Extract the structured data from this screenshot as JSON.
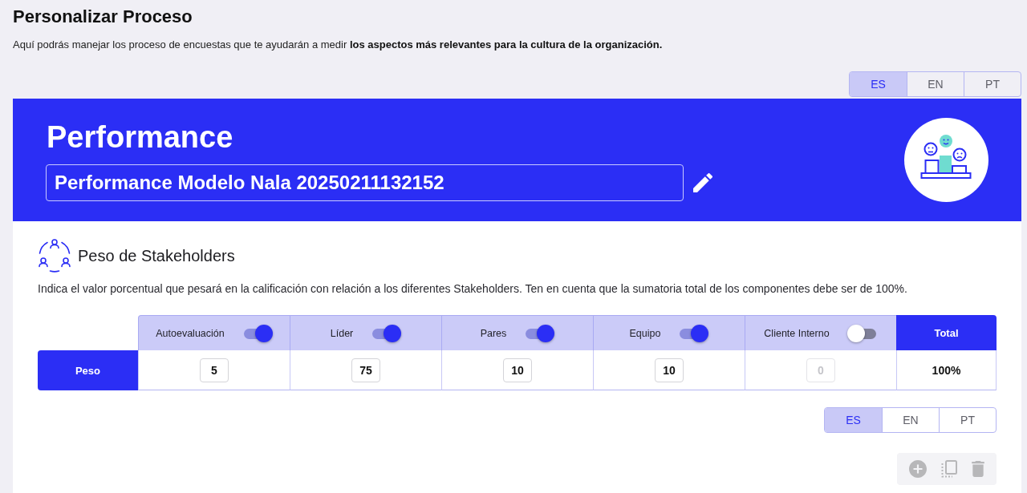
{
  "page": {
    "title": "Personalizar Proceso",
    "description": "Aquí podrás manejar los proceso de encuestas que te ayudarán a medir **los aspectos más relevantes para la cultura de la organización.**"
  },
  "header_language_tabs": [
    {
      "label": "ES",
      "selected": true
    },
    {
      "label": "EN",
      "selected": false
    },
    {
      "label": "PT",
      "selected": false
    }
  ],
  "banner": {
    "title": "Performance",
    "name_field": {
      "value": "Performance Modelo Nala 20250211132152"
    }
  },
  "stakeholders": {
    "title": "Peso de Stakeholders",
    "description": "Indica el valor porcentual que pesará en la calificación con relación a los diferentes Stakeholders. Ten en cuenta que la sumatoria total de los componentes debe ser de 100%.",
    "row_label": "Peso",
    "total_label": "Total",
    "total_value": "100%",
    "columns": [
      {
        "label": "Autoevaluación",
        "on": true,
        "value": "5"
      },
      {
        "label": "Líder",
        "on": true,
        "value": "75"
      },
      {
        "label": "Pares",
        "on": true,
        "value": "10"
      },
      {
        "label": "Equipo",
        "on": true,
        "value": "10"
      },
      {
        "label": "Cliente Interno",
        "on": false,
        "value": "0"
      }
    ]
  },
  "section_language_tabs": [
    {
      "label": "ES",
      "selected": true
    },
    {
      "label": "EN",
      "selected": false
    },
    {
      "label": "PT",
      "selected": false
    }
  ],
  "actions": [
    {
      "kind": "add",
      "disabled": true
    },
    {
      "kind": "copy",
      "disabled": true
    },
    {
      "kind": "delete",
      "disabled": true
    }
  ]
}
